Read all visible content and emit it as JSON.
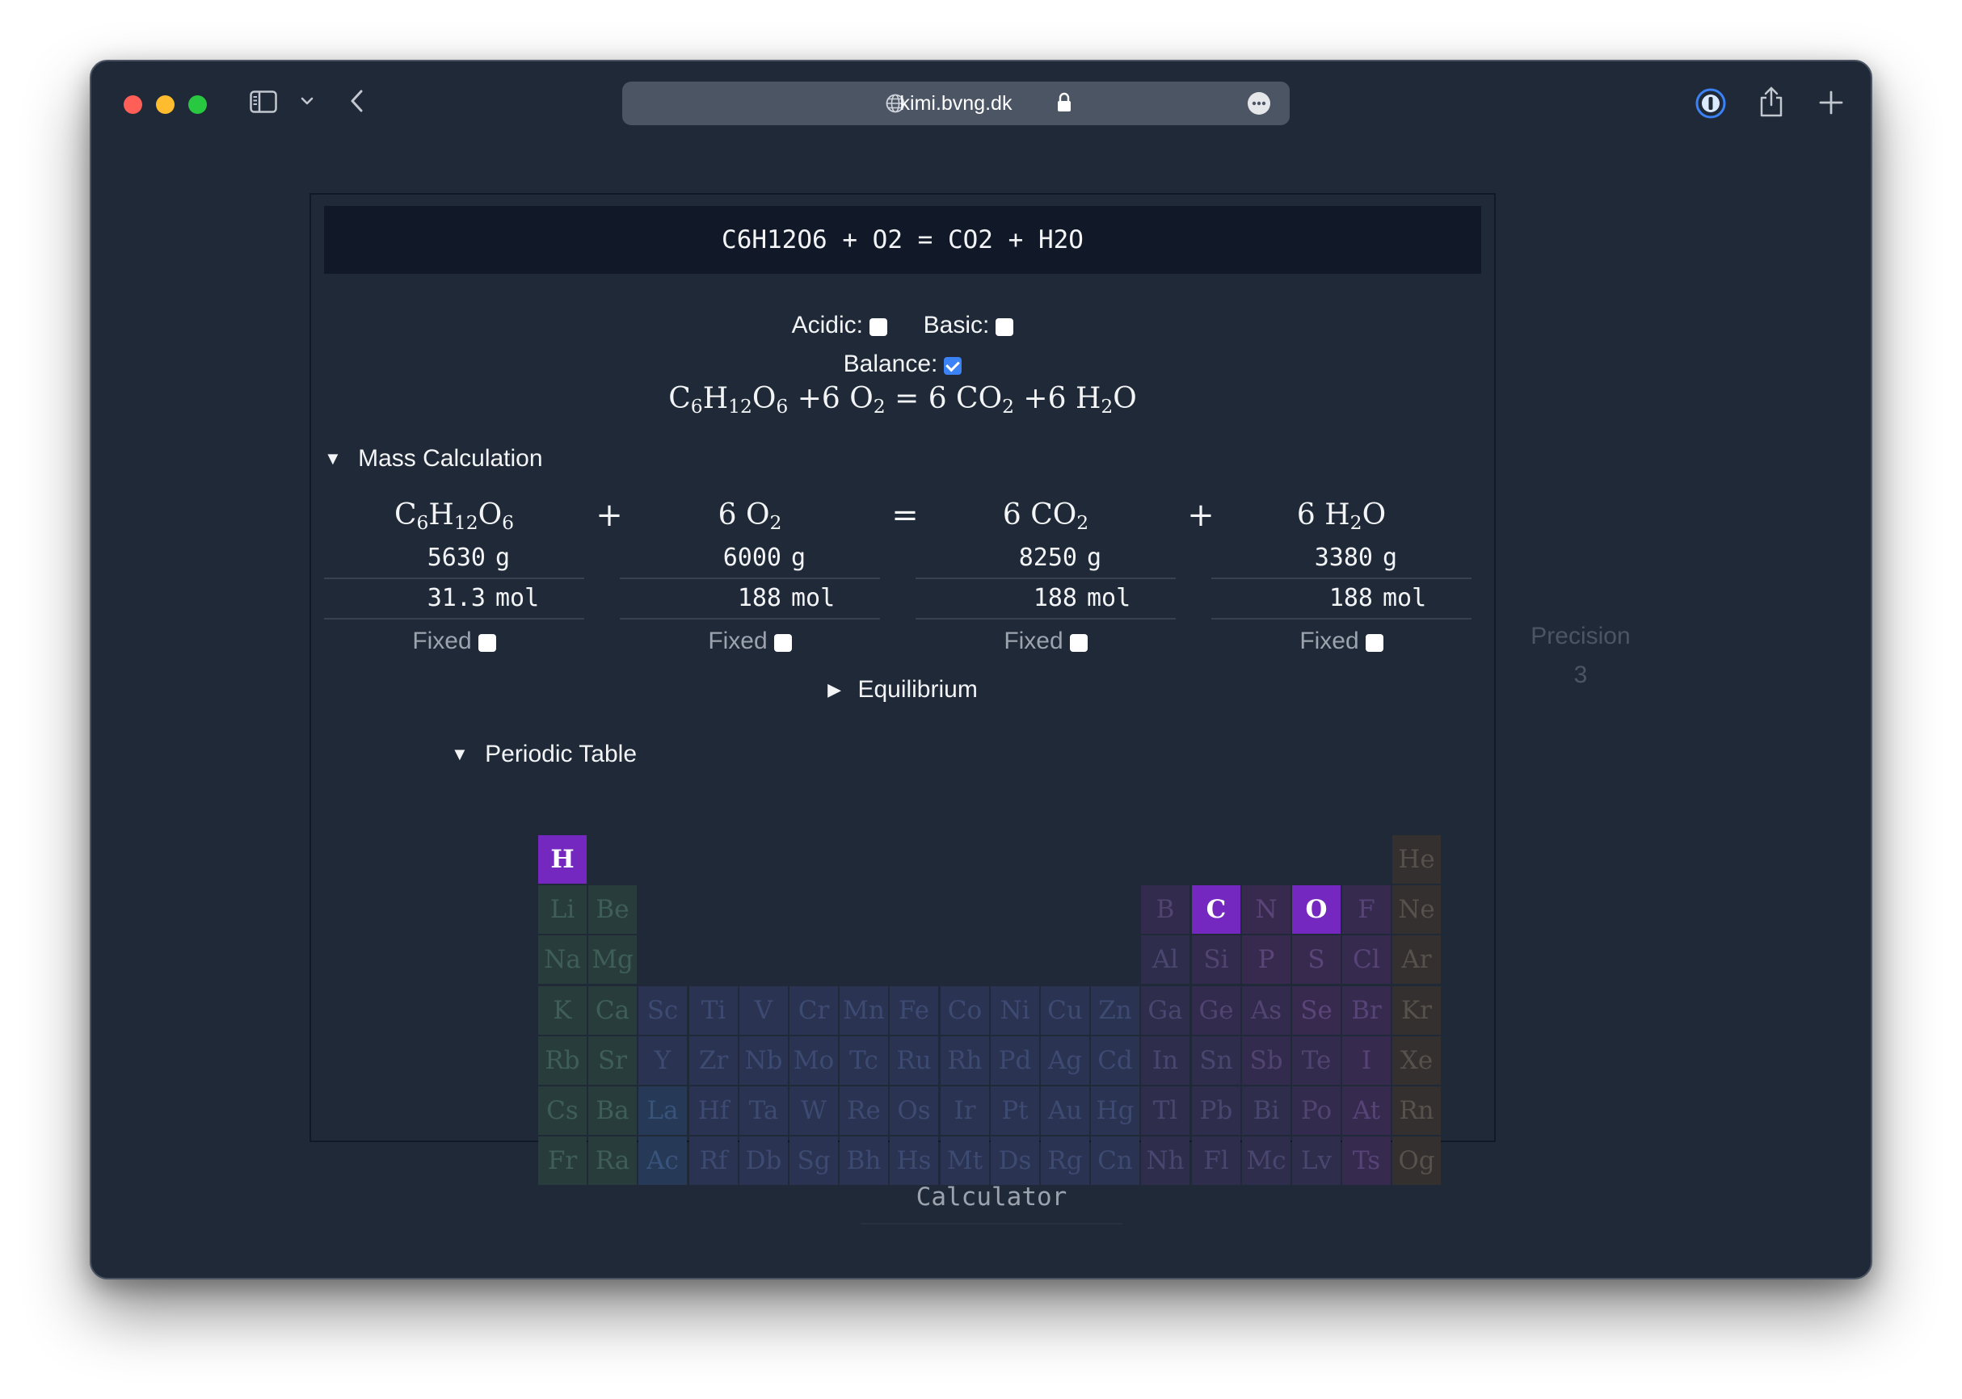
{
  "browser": {
    "url": "kimi.bvng.dk"
  },
  "app": {
    "equation_input": "C6H12O6 + O2 = CO2 + H2O",
    "options": {
      "acidic_label": "Acidic:",
      "acidic_checked": false,
      "basic_label": "Basic:",
      "basic_checked": false,
      "balance_label": "Balance:",
      "balance_checked": true
    },
    "balanced": {
      "t1": "C",
      "t1s": "6",
      "t2": "H",
      "t2s": "12",
      "t3": "O",
      "t3s": "6",
      "plus1": " +6 O",
      "o2s": "2",
      "eq": " = ",
      "co2a": "6 CO",
      "co2s": "2",
      "plus2": " +6 H",
      "h2os": "2",
      "h2ob": "O"
    },
    "mass_calculation": {
      "label": "Mass Calculation",
      "operators": [
        "+",
        "=",
        "+"
      ],
      "species": [
        {
          "formula_parts": [
            "C",
            "6",
            "H",
            "12",
            "O",
            "6"
          ],
          "mass": "5630",
          "mass_unit": "g",
          "moles": "31.3",
          "mol_unit": "mol",
          "fixed_label": "Fixed",
          "fixed": false
        },
        {
          "formula_parts": [
            "6 O",
            "2"
          ],
          "mass": "6000",
          "mass_unit": "g",
          "moles": "188",
          "mol_unit": "mol",
          "fixed_label": "Fixed",
          "fixed": false
        },
        {
          "formula_parts": [
            "6 CO",
            "2"
          ],
          "mass": "8250",
          "mass_unit": "g",
          "moles": "188",
          "mol_unit": "mol",
          "fixed_label": "Fixed",
          "fixed": false
        },
        {
          "formula_parts": [
            "6 H",
            "2",
            "O"
          ],
          "mass": "3380",
          "mass_unit": "g",
          "moles": "188",
          "mol_unit": "mol",
          "fixed_label": "Fixed",
          "fixed": false
        }
      ]
    },
    "precision": {
      "label": "Precision",
      "value": "3"
    },
    "equilibrium_label": "Equilibrium",
    "periodic_table": {
      "label": "Periodic Table",
      "active_elements": [
        "H",
        "C",
        "O"
      ],
      "elements": [
        {
          "s": "H",
          "r": 1,
          "c": 1,
          "cat": "nonmetal"
        },
        {
          "s": "He",
          "r": 1,
          "c": 18,
          "cat": "noble"
        },
        {
          "s": "Li",
          "r": 2,
          "c": 1,
          "cat": "alkali"
        },
        {
          "s": "Be",
          "r": 2,
          "c": 2,
          "cat": "alkaline"
        },
        {
          "s": "B",
          "r": 2,
          "c": 13,
          "cat": "metalloid"
        },
        {
          "s": "C",
          "r": 2,
          "c": 14,
          "cat": "nonmetal"
        },
        {
          "s": "N",
          "r": 2,
          "c": 15,
          "cat": "nonmetal"
        },
        {
          "s": "O",
          "r": 2,
          "c": 16,
          "cat": "nonmetal"
        },
        {
          "s": "F",
          "r": 2,
          "c": 17,
          "cat": "halogen"
        },
        {
          "s": "Ne",
          "r": 2,
          "c": 18,
          "cat": "noble"
        },
        {
          "s": "Na",
          "r": 3,
          "c": 1,
          "cat": "alkali"
        },
        {
          "s": "Mg",
          "r": 3,
          "c": 2,
          "cat": "alkaline"
        },
        {
          "s": "Al",
          "r": 3,
          "c": 13,
          "cat": "post"
        },
        {
          "s": "Si",
          "r": 3,
          "c": 14,
          "cat": "metalloid"
        },
        {
          "s": "P",
          "r": 3,
          "c": 15,
          "cat": "nonmetal"
        },
        {
          "s": "S",
          "r": 3,
          "c": 16,
          "cat": "nonmetal"
        },
        {
          "s": "Cl",
          "r": 3,
          "c": 17,
          "cat": "halogen"
        },
        {
          "s": "Ar",
          "r": 3,
          "c": 18,
          "cat": "noble"
        },
        {
          "s": "K",
          "r": 4,
          "c": 1,
          "cat": "alkali"
        },
        {
          "s": "Ca",
          "r": 4,
          "c": 2,
          "cat": "alkaline"
        },
        {
          "s": "Sc",
          "r": 4,
          "c": 3,
          "cat": "transition"
        },
        {
          "s": "Ti",
          "r": 4,
          "c": 4,
          "cat": "transition"
        },
        {
          "s": "V",
          "r": 4,
          "c": 5,
          "cat": "transition"
        },
        {
          "s": "Cr",
          "r": 4,
          "c": 6,
          "cat": "transition"
        },
        {
          "s": "Mn",
          "r": 4,
          "c": 7,
          "cat": "transition"
        },
        {
          "s": "Fe",
          "r": 4,
          "c": 8,
          "cat": "transition"
        },
        {
          "s": "Co",
          "r": 4,
          "c": 9,
          "cat": "transition"
        },
        {
          "s": "Ni",
          "r": 4,
          "c": 10,
          "cat": "transition"
        },
        {
          "s": "Cu",
          "r": 4,
          "c": 11,
          "cat": "transition"
        },
        {
          "s": "Zn",
          "r": 4,
          "c": 12,
          "cat": "transition"
        },
        {
          "s": "Ga",
          "r": 4,
          "c": 13,
          "cat": "post"
        },
        {
          "s": "Ge",
          "r": 4,
          "c": 14,
          "cat": "metalloid"
        },
        {
          "s": "As",
          "r": 4,
          "c": 15,
          "cat": "metalloid"
        },
        {
          "s": "Se",
          "r": 4,
          "c": 16,
          "cat": "nonmetal"
        },
        {
          "s": "Br",
          "r": 4,
          "c": 17,
          "cat": "halogen"
        },
        {
          "s": "Kr",
          "r": 4,
          "c": 18,
          "cat": "noble"
        },
        {
          "s": "Rb",
          "r": 5,
          "c": 1,
          "cat": "alkali"
        },
        {
          "s": "Sr",
          "r": 5,
          "c": 2,
          "cat": "alkaline"
        },
        {
          "s": "Y",
          "r": 5,
          "c": 3,
          "cat": "transition"
        },
        {
          "s": "Zr",
          "r": 5,
          "c": 4,
          "cat": "transition"
        },
        {
          "s": "Nb",
          "r": 5,
          "c": 5,
          "cat": "transition"
        },
        {
          "s": "Mo",
          "r": 5,
          "c": 6,
          "cat": "transition"
        },
        {
          "s": "Tc",
          "r": 5,
          "c": 7,
          "cat": "transition"
        },
        {
          "s": "Ru",
          "r": 5,
          "c": 8,
          "cat": "transition"
        },
        {
          "s": "Rh",
          "r": 5,
          "c": 9,
          "cat": "transition"
        },
        {
          "s": "Pd",
          "r": 5,
          "c": 10,
          "cat": "transition"
        },
        {
          "s": "Ag",
          "r": 5,
          "c": 11,
          "cat": "transition"
        },
        {
          "s": "Cd",
          "r": 5,
          "c": 12,
          "cat": "transition"
        },
        {
          "s": "In",
          "r": 5,
          "c": 13,
          "cat": "post"
        },
        {
          "s": "Sn",
          "r": 5,
          "c": 14,
          "cat": "post"
        },
        {
          "s": "Sb",
          "r": 5,
          "c": 15,
          "cat": "metalloid"
        },
        {
          "s": "Te",
          "r": 5,
          "c": 16,
          "cat": "metalloid"
        },
        {
          "s": "I",
          "r": 5,
          "c": 17,
          "cat": "halogen"
        },
        {
          "s": "Xe",
          "r": 5,
          "c": 18,
          "cat": "noble"
        },
        {
          "s": "Cs",
          "r": 6,
          "c": 1,
          "cat": "alkali"
        },
        {
          "s": "Ba",
          "r": 6,
          "c": 2,
          "cat": "alkaline"
        },
        {
          "s": "La",
          "r": 6,
          "c": 3,
          "cat": "lanth"
        },
        {
          "s": "Hf",
          "r": 6,
          "c": 4,
          "cat": "transition"
        },
        {
          "s": "Ta",
          "r": 6,
          "c": 5,
          "cat": "transition"
        },
        {
          "s": "W",
          "r": 6,
          "c": 6,
          "cat": "transition"
        },
        {
          "s": "Re",
          "r": 6,
          "c": 7,
          "cat": "transition"
        },
        {
          "s": "Os",
          "r": 6,
          "c": 8,
          "cat": "transition"
        },
        {
          "s": "Ir",
          "r": 6,
          "c": 9,
          "cat": "transition"
        },
        {
          "s": "Pt",
          "r": 6,
          "c": 10,
          "cat": "transition"
        },
        {
          "s": "Au",
          "r": 6,
          "c": 11,
          "cat": "transition"
        },
        {
          "s": "Hg",
          "r": 6,
          "c": 12,
          "cat": "transition"
        },
        {
          "s": "Tl",
          "r": 6,
          "c": 13,
          "cat": "post"
        },
        {
          "s": "Pb",
          "r": 6,
          "c": 14,
          "cat": "post"
        },
        {
          "s": "Bi",
          "r": 6,
          "c": 15,
          "cat": "post"
        },
        {
          "s": "Po",
          "r": 6,
          "c": 16,
          "cat": "metalloid"
        },
        {
          "s": "At",
          "r": 6,
          "c": 17,
          "cat": "halogen"
        },
        {
          "s": "Rn",
          "r": 6,
          "c": 18,
          "cat": "noble"
        },
        {
          "s": "Fr",
          "r": 7,
          "c": 1,
          "cat": "alkali"
        },
        {
          "s": "Ra",
          "r": 7,
          "c": 2,
          "cat": "alkaline"
        },
        {
          "s": "Ac",
          "r": 7,
          "c": 3,
          "cat": "act"
        },
        {
          "s": "Rf",
          "r": 7,
          "c": 4,
          "cat": "transition"
        },
        {
          "s": "Db",
          "r": 7,
          "c": 5,
          "cat": "transition"
        },
        {
          "s": "Sg",
          "r": 7,
          "c": 6,
          "cat": "transition"
        },
        {
          "s": "Bh",
          "r": 7,
          "c": 7,
          "cat": "transition"
        },
        {
          "s": "Hs",
          "r": 7,
          "c": 8,
          "cat": "transition"
        },
        {
          "s": "Mt",
          "r": 7,
          "c": 9,
          "cat": "transition"
        },
        {
          "s": "Ds",
          "r": 7,
          "c": 10,
          "cat": "transition"
        },
        {
          "s": "Rg",
          "r": 7,
          "c": 11,
          "cat": "transition"
        },
        {
          "s": "Cn",
          "r": 7,
          "c": 12,
          "cat": "transition"
        },
        {
          "s": "Nh",
          "r": 7,
          "c": 13,
          "cat": "post"
        },
        {
          "s": "Fl",
          "r": 7,
          "c": 14,
          "cat": "post"
        },
        {
          "s": "Mc",
          "r": 7,
          "c": 15,
          "cat": "post"
        },
        {
          "s": "Lv",
          "r": 7,
          "c": 16,
          "cat": "post"
        },
        {
          "s": "Ts",
          "r": 7,
          "c": 17,
          "cat": "halogen"
        },
        {
          "s": "Og",
          "r": 7,
          "c": 18,
          "cat": "noble"
        }
      ]
    },
    "calculator_button": "Calculator"
  },
  "colors": {
    "page_bg": "#1f2937",
    "input_bg": "#111827",
    "active_element": "#7428c0",
    "checkbox_checked": "#3b82f6"
  }
}
